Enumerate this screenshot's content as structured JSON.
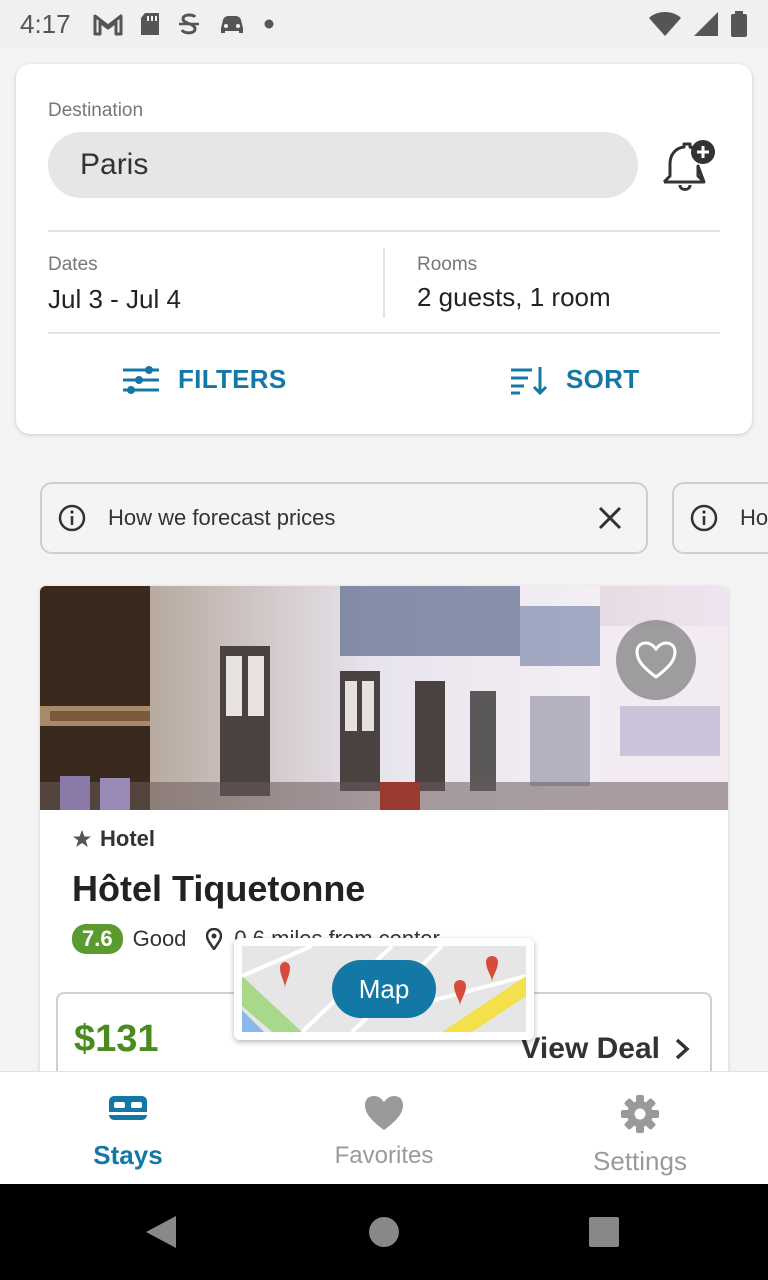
{
  "status_bar": {
    "time": "4:17",
    "icons": [
      "gmail-icon",
      "sd-card-icon",
      "s-icon",
      "car-icon",
      "dot-icon"
    ],
    "right_icons": [
      "wifi-icon",
      "signal-icon",
      "battery-icon"
    ]
  },
  "search": {
    "destination_label": "Destination",
    "destination_value": "Paris",
    "dates_label": "Dates",
    "dates_value": "Jul 3 - Jul 4",
    "rooms_label": "Rooms",
    "rooms_value": "2 guests, 1 room",
    "filters_label": "FILTERS",
    "sort_label": "SORT"
  },
  "info_chips": [
    {
      "text": "How we forecast prices"
    },
    {
      "text": "Ho"
    }
  ],
  "hotel": {
    "type": "Hotel",
    "name": "Hôtel Tiquetonne",
    "rating": "7.6",
    "rating_text": "Good",
    "distance": "0.6 miles from center",
    "price": "$131",
    "view_deal": "View Deal"
  },
  "map": {
    "label": "Map"
  },
  "bottom_nav": {
    "items": [
      {
        "label": "Stays",
        "active": true
      },
      {
        "label": "Favorites",
        "active": false
      },
      {
        "label": "Settings",
        "active": false
      }
    ]
  },
  "colors": {
    "accent": "#1478a6",
    "rating_green": "#5a9a2e",
    "price_green": "#4a8a1e"
  }
}
